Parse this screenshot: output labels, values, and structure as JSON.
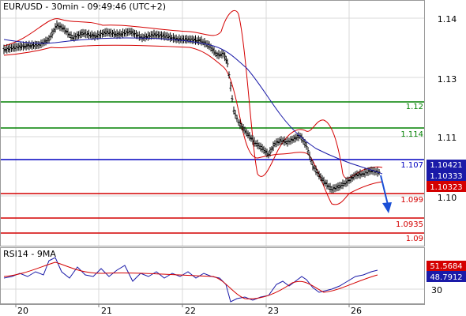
{
  "header": {
    "title": "EUR/USD - 30min - 09:49:46 (UTC+2)"
  },
  "indicator": {
    "title": "RSI14 - 9MA",
    "rsi_value": "48.7912",
    "ma_value": "51.5684",
    "tick_label": "30"
  },
  "colors": {
    "price": "#000000",
    "bollinger": "#d40000",
    "moving_average": "#1a1aa8",
    "support_line": "#d40000",
    "resistance_line": "#008000",
    "pivot_line": "#0000c0",
    "arrow": "#1a4fd6",
    "grid": "#d8d8d8",
    "badge_blue": "#1a1aa8",
    "badge_dark": "#1a1aa8",
    "badge_red": "#d40000"
  },
  "chart_data": {
    "type": "candlestick",
    "symbol": "EUR/USD",
    "timeframe": "30min",
    "x_tick_labels": [
      "20",
      "21",
      "22",
      "23",
      "26"
    ],
    "y_tick_labels": [
      "1.14",
      "1.13",
      "1.11",
      "1.10"
    ],
    "levels": [
      {
        "value": 1.12,
        "label": "1.12",
        "kind": "resistance"
      },
      {
        "value": 1.114,
        "label": "1.114",
        "kind": "resistance"
      },
      {
        "value": 1.107,
        "label": "1.107",
        "kind": "pivot"
      },
      {
        "value": 1.099,
        "label": "1.099",
        "kind": "support"
      },
      {
        "value": 1.0935,
        "label": "1.0935",
        "kind": "support"
      },
      {
        "value": 1.09,
        "label": "1.09",
        "kind": "support"
      }
    ],
    "price_badges": [
      {
        "value": "1.10421",
        "kind": "blue"
      },
      {
        "value": "1.10333",
        "kind": "dark"
      },
      {
        "value": "1.10323",
        "kind": "red"
      }
    ],
    "forecast": "down-arrow"
  }
}
